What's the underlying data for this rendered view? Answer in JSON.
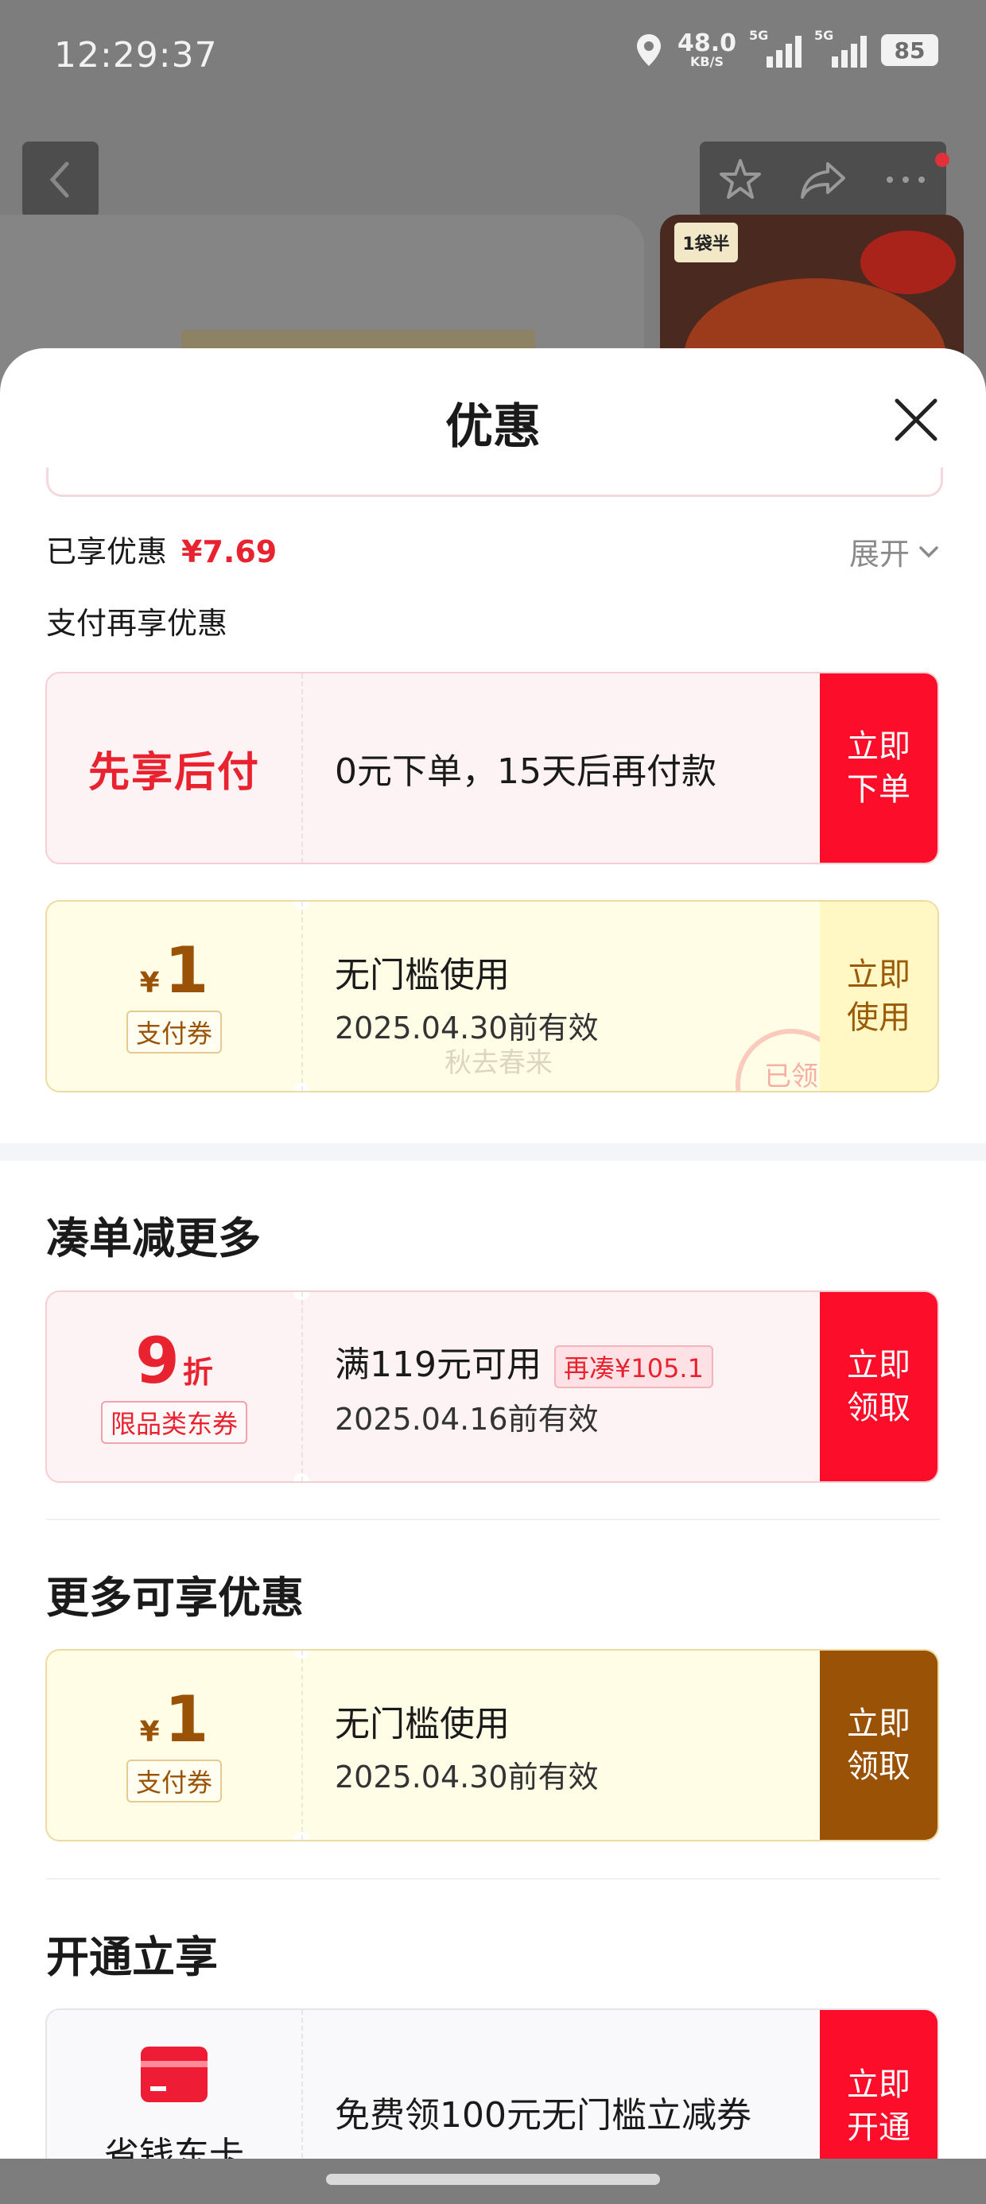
{
  "status_bar": {
    "time": "12:29:37",
    "net_speed_value": "48.0",
    "net_speed_unit": "KB/S",
    "signal1_label": "5G",
    "signal2_label": "5G",
    "battery": "85"
  },
  "background_page": {
    "thumb_logo": "1袋半"
  },
  "sheet": {
    "title": "优惠",
    "enjoyed_label": "已享优惠",
    "enjoyed_amount": "¥7.69",
    "expand_label": "展开",
    "pay_more_label": "支付再享优惠",
    "bnpl": {
      "name": "先享后付",
      "desc": "0元下单，15天后再付款",
      "button": "立即下单"
    },
    "pay_coupon_1": {
      "currency": "¥",
      "amount": "1",
      "type": "支付券",
      "condition": "无门槛使用",
      "expiry": "2025.04.30前有效",
      "button": "立即使用",
      "watermark": "秋去春来",
      "stamp": "已领"
    },
    "section_bundle": {
      "title": "凑单减更多",
      "coupon": {
        "value": "9",
        "unit": "折",
        "type": "限品类东券",
        "condition": "满119元可用",
        "tag": "再凑¥105.1",
        "expiry": "2025.04.16前有效",
        "button": "立即领取"
      }
    },
    "section_more": {
      "title": "更多可享优惠",
      "coupon": {
        "currency": "¥",
        "amount": "1",
        "type": "支付券",
        "condition": "无门槛使用",
        "expiry": "2025.04.30前有效",
        "button": "立即领取"
      }
    },
    "section_open": {
      "title": "开通立享",
      "card": {
        "name": "省钱东卡",
        "desc": "免费领100元无门槛立减券",
        "button": "立即开通"
      }
    }
  },
  "colors": {
    "accent_red": "#fc0d2a",
    "brown": "#9a5206",
    "coupon_yellow": "#fffde6",
    "coupon_pink": "#fdf3f4"
  },
  "icons": [
    "location-icon",
    "chevron-left-icon",
    "star-icon",
    "share-icon",
    "more-icon",
    "close-icon",
    "chevron-down-icon",
    "card-icon"
  ]
}
